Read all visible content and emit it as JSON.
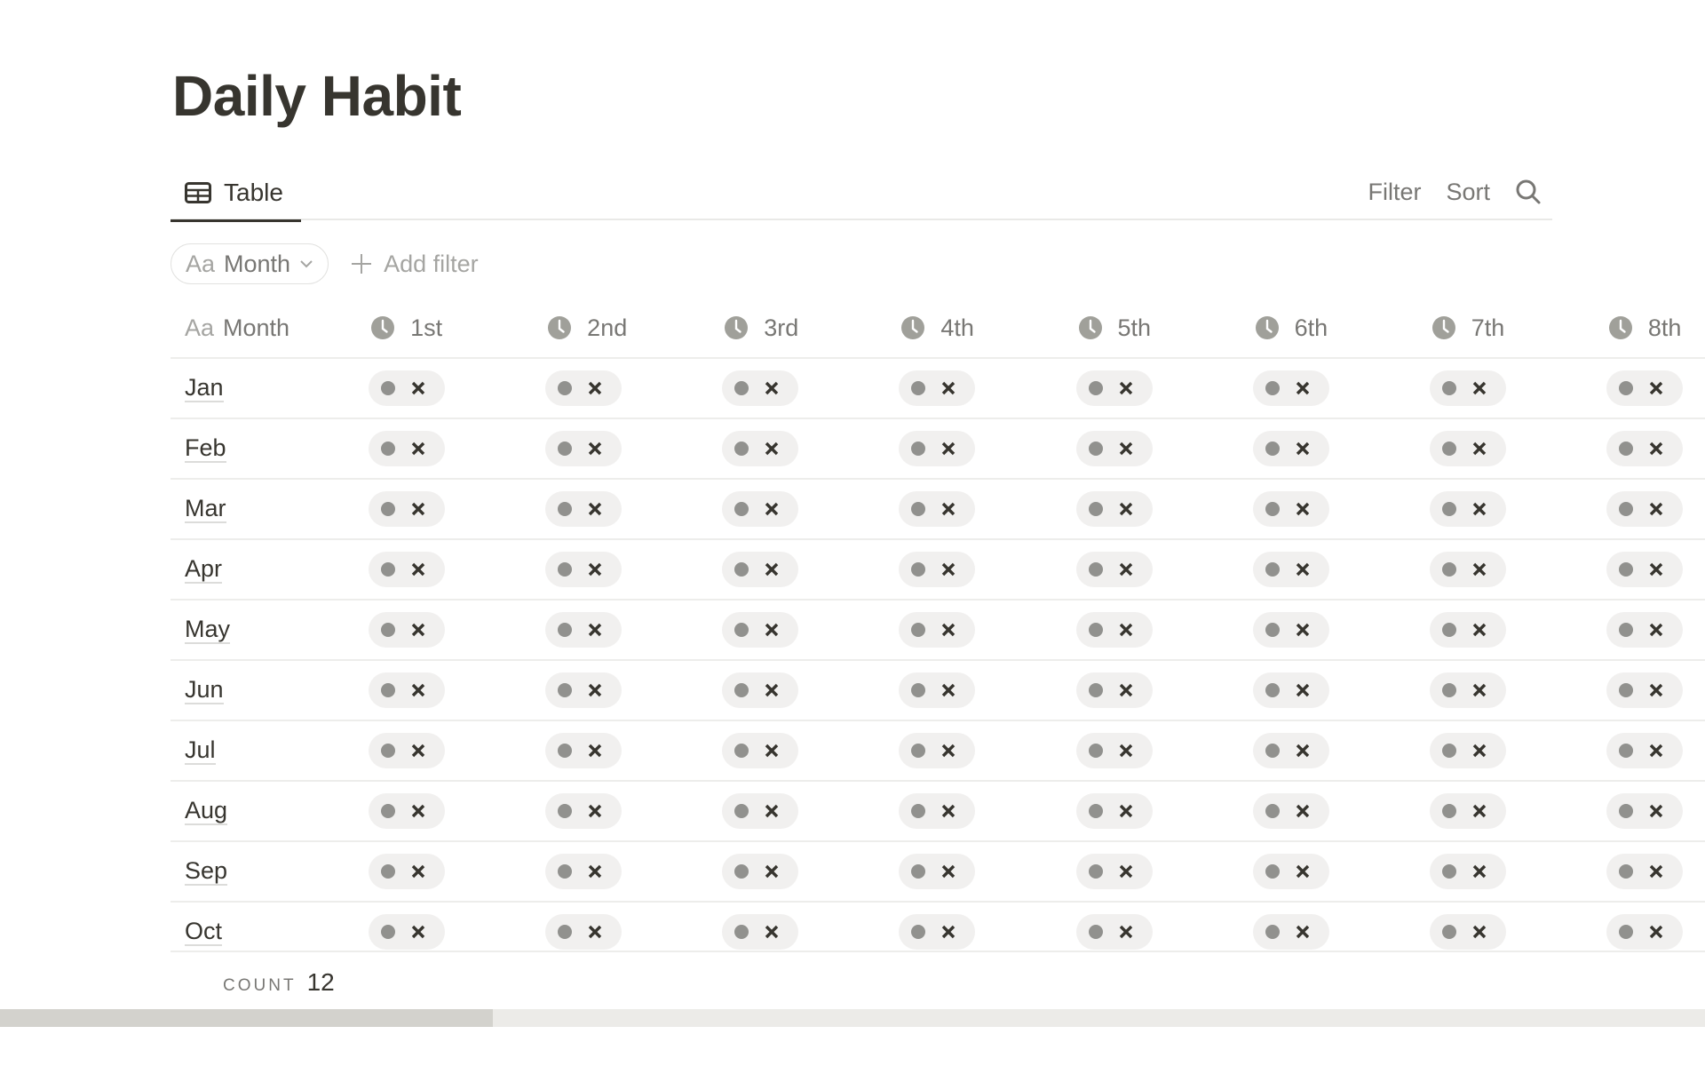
{
  "page": {
    "title": "Daily Habit"
  },
  "view": {
    "tab_label": "Table",
    "tab_icon": "table-icon",
    "toolbar": {
      "filter_label": "Filter",
      "sort_label": "Sort",
      "search_icon": "search-icon"
    }
  },
  "filters": {
    "month_pill": {
      "prefix": "Aa",
      "label": "Month",
      "icon": "chevron-down-icon"
    },
    "add_filter_label": "Add filter"
  },
  "table": {
    "month_column": {
      "prefix": "Aa",
      "label": "Month"
    },
    "day_columns": [
      "1st",
      "2nd",
      "3rd",
      "4th",
      "5th",
      "6th",
      "7th",
      "8th"
    ],
    "day_column_icon": "clock-icon",
    "rows": [
      {
        "month": "Jan",
        "values": [
          "x",
          "x",
          "x",
          "x",
          "x",
          "x",
          "x",
          "x"
        ]
      },
      {
        "month": "Feb",
        "values": [
          "x",
          "x",
          "x",
          "x",
          "x",
          "x",
          "x",
          "x"
        ]
      },
      {
        "month": "Mar",
        "values": [
          "x",
          "x",
          "x",
          "x",
          "x",
          "x",
          "x",
          "x"
        ]
      },
      {
        "month": "Apr",
        "values": [
          "x",
          "x",
          "x",
          "x",
          "x",
          "x",
          "x",
          "x"
        ]
      },
      {
        "month": "May",
        "values": [
          "x",
          "x",
          "x",
          "x",
          "x",
          "x",
          "x",
          "x"
        ]
      },
      {
        "month": "Jun",
        "values": [
          "x",
          "x",
          "x",
          "x",
          "x",
          "x",
          "x",
          "x"
        ]
      },
      {
        "month": "Jul",
        "values": [
          "x",
          "x",
          "x",
          "x",
          "x",
          "x",
          "x",
          "x"
        ]
      },
      {
        "month": "Aug",
        "values": [
          "x",
          "x",
          "x",
          "x",
          "x",
          "x",
          "x",
          "x"
        ]
      },
      {
        "month": "Sep",
        "values": [
          "x",
          "x",
          "x",
          "x",
          "x",
          "x",
          "x",
          "x"
        ]
      },
      {
        "month": "Oct",
        "values": [
          "x",
          "x",
          "x",
          "x",
          "x",
          "x",
          "x",
          "x"
        ]
      }
    ],
    "status_value_label": "✖"
  },
  "footer": {
    "count_label": "COUNT",
    "count_value": "12"
  },
  "scroll": {
    "horizontal_position_fraction": 0.29
  },
  "colors": {
    "text_primary": "#37352f",
    "text_secondary": "#787774",
    "pill_bg": "#f1f0ef",
    "dot": "#91918e",
    "clock": "#a0a09a",
    "divider": "#ededeb"
  }
}
